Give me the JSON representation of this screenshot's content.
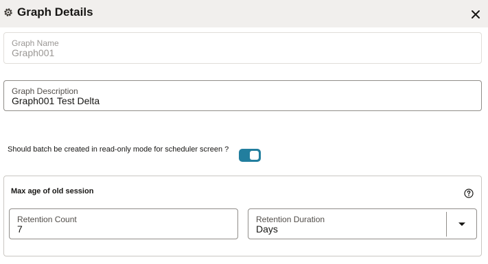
{
  "dialog": {
    "title": "Graph Details",
    "icons": {
      "header": "gear-icon",
      "close": "close-icon"
    }
  },
  "graph_name": {
    "label": "Graph Name",
    "value": "Graph001"
  },
  "graph_description": {
    "label": "Graph Description",
    "value": "Graph001 Test Delta"
  },
  "batch_readonly": {
    "question": "Should batch be created in read-only mode for scheduler screen ?",
    "enabled": true,
    "accent_color": "#227e9e"
  },
  "session": {
    "title": "Max age of old session",
    "help_icon": "help-circle-icon",
    "retention_count": {
      "label": "Retention Count",
      "value": "7"
    },
    "retention_duration": {
      "label": "Retention Duration",
      "value": "Days"
    }
  }
}
